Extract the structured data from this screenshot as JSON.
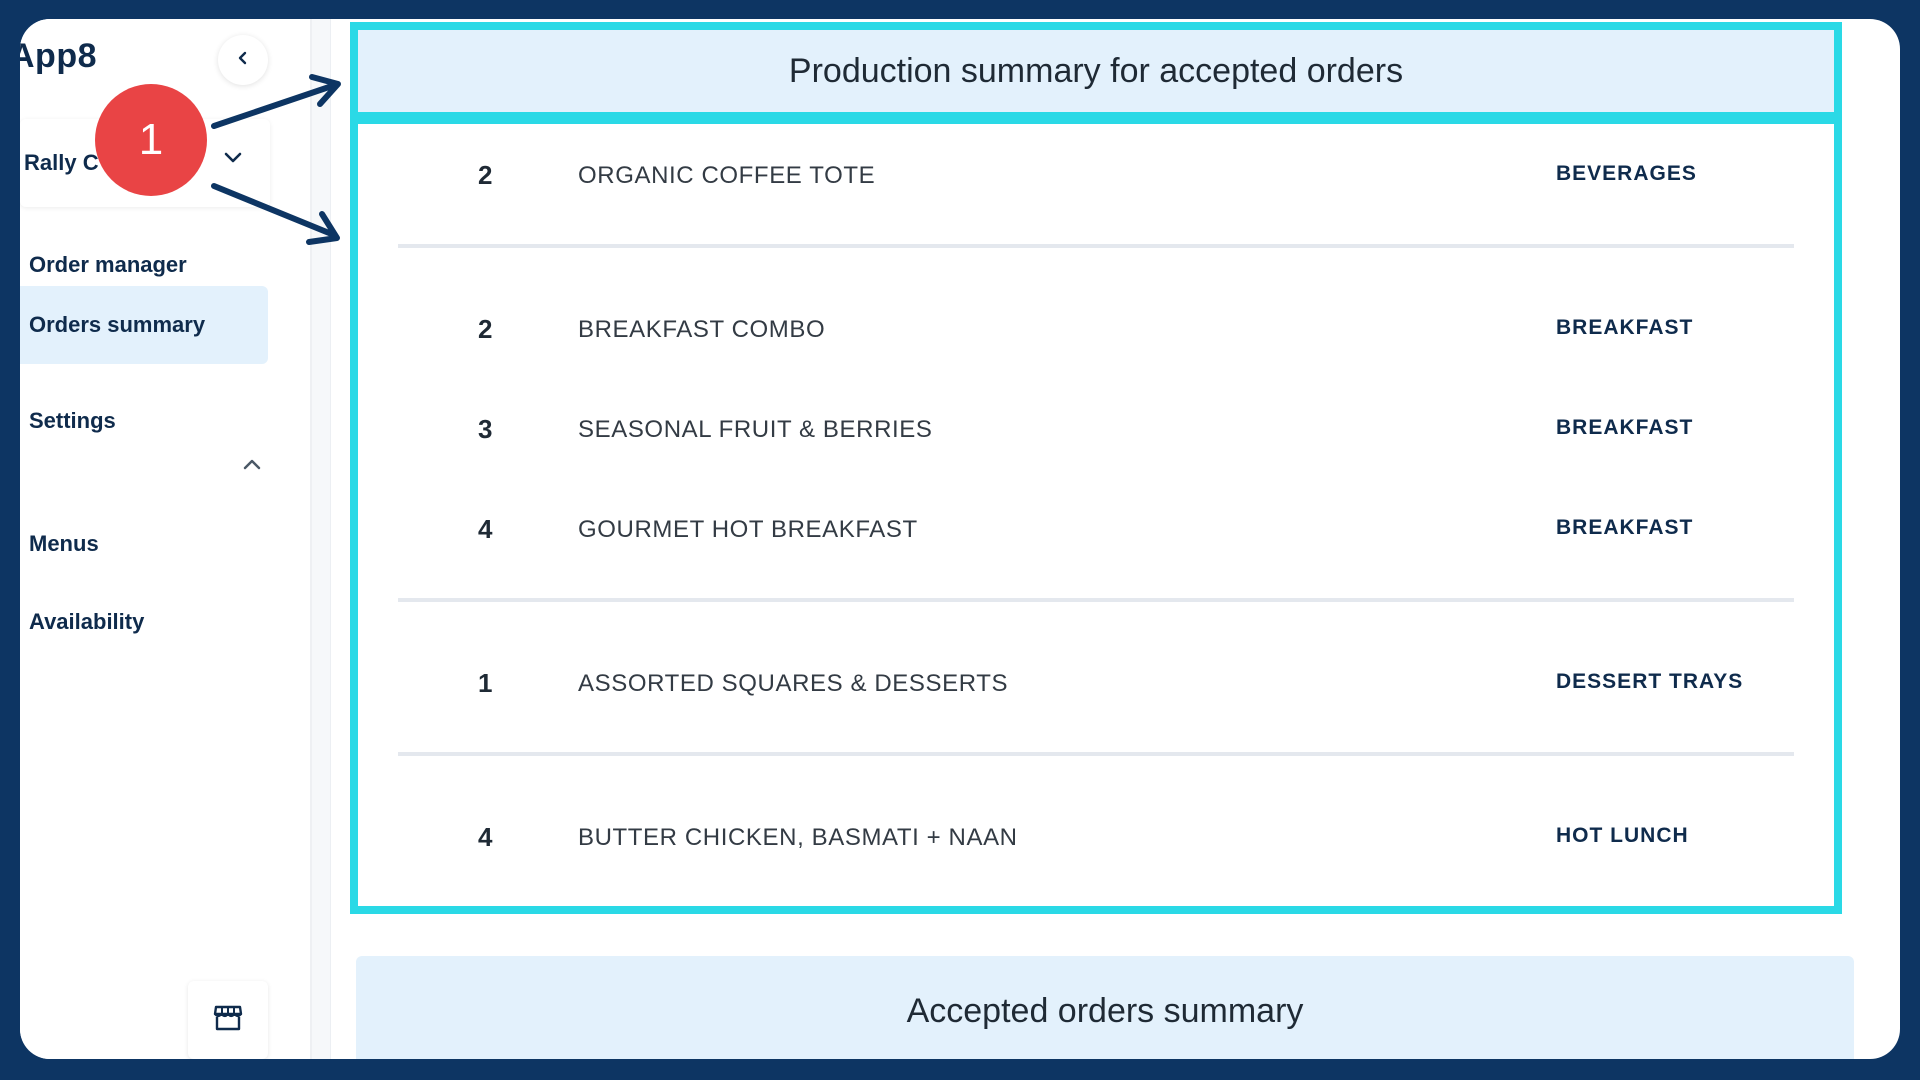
{
  "app": {
    "logo": "App8"
  },
  "sidebar": {
    "account_label": "Rally C",
    "nav_items": [
      {
        "label": "Order manager"
      },
      {
        "label": "Orders summary",
        "active": true
      },
      {
        "label": "Settings"
      },
      {
        "label": "Menus"
      },
      {
        "label": "Availability"
      }
    ],
    "icons": [
      "chevron-left-icon",
      "chevron-down-icon",
      "chevron-up-icon",
      "store-icon"
    ]
  },
  "production_summary": {
    "title": "Production summary for accepted orders",
    "groups": [
      [
        {
          "qty": "2",
          "item": "ORGANIC COFFEE TOTE",
          "category": "BEVERAGES"
        }
      ],
      [
        {
          "qty": "2",
          "item": "BREAKFAST COMBO",
          "category": "BREAKFAST"
        },
        {
          "qty": "3",
          "item": "SEASONAL FRUIT & BERRIES",
          "category": "BREAKFAST"
        },
        {
          "qty": "4",
          "item": "GOURMET HOT BREAKFAST",
          "category": "BREAKFAST"
        }
      ],
      [
        {
          "qty": "1",
          "item": "ASSORTED SQUARES & DESSERTS",
          "category": "DESSERT TRAYS"
        }
      ],
      [
        {
          "qty": "4",
          "item": "BUTTER CHICKEN, BASMATI + NAAN",
          "category": "HOT LUNCH"
        }
      ]
    ]
  },
  "accepted_summary": {
    "title": "Accepted orders summary"
  },
  "annotation": {
    "step_number": "1"
  },
  "colors": {
    "frame": "#0d3563",
    "highlight": "#2ad9e6",
    "header_bg": "#e3f1fc",
    "badge": "#e94445",
    "text_dark": "#0f2b4c"
  }
}
